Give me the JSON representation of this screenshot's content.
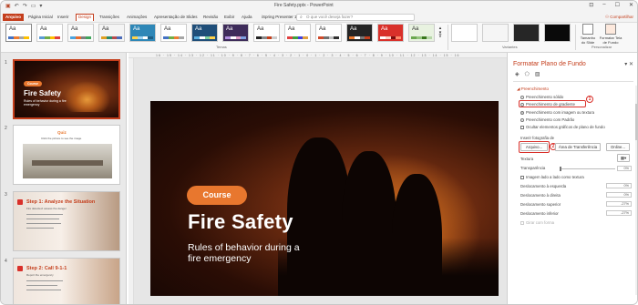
{
  "window": {
    "doc_title": "Fire Safety.pptx - PowerPoint",
    "search_placeholder": "O que você deseja fazer?",
    "share_label": "Compartilhar"
  },
  "tabs": [
    {
      "label": "Arquivo",
      "active": false
    },
    {
      "label": "Página Inicial",
      "active": false
    },
    {
      "label": "Inserir",
      "active": false
    },
    {
      "label": "Design",
      "active": true
    },
    {
      "label": "Transições",
      "active": false
    },
    {
      "label": "Animações",
      "active": false
    },
    {
      "label": "Apresentação de Slides",
      "active": false
    },
    {
      "label": "Revisão",
      "active": false
    },
    {
      "label": "Exibir",
      "active": false
    },
    {
      "label": "Ajuda",
      "active": false
    },
    {
      "label": "iSpring Presenter 10",
      "active": false
    }
  ],
  "ribbon": {
    "themes_group_label": "Temas",
    "variants_group_label": "Variantes",
    "customize_group_label": "Personalizar",
    "slide_size_label": "Tamanho do Slide",
    "format_background_label": "Formatar Tela de Fundo",
    "theme_sample_text": "Aa",
    "themes": [
      {
        "bg": "#ffffff",
        "text": "#333333",
        "bar": [
          "#4472c4",
          "#ed7d31",
          "#a5a5a5",
          "#ffc000"
        ]
      },
      {
        "bg": "#ffffff",
        "text": "#333333",
        "bar": [
          "#5b9bd5",
          "#70ad47",
          "#ffc000",
          "#e04040"
        ]
      },
      {
        "bg": "#fafafa",
        "text": "#333333",
        "bar": [
          "#4aa3df",
          "#e86b2d",
          "#7f7f7f",
          "#3fa55b"
        ]
      },
      {
        "bg": "#f4f4f4",
        "text": "#333333",
        "bar": [
          "#e0a020",
          "#2a8a6a",
          "#b84a4a",
          "#4a6ab8"
        ]
      },
      {
        "bg": "#2e87b7",
        "text": "#ffffff",
        "bar": [
          "#ffd44a",
          "#9fd3f0",
          "#ffffff",
          "#1d5e85"
        ]
      },
      {
        "bg": "#ffffff",
        "text": "#333333",
        "bar": [
          "#4472c4",
          "#70ad47",
          "#ed7d31",
          "#a5a5a5"
        ]
      },
      {
        "bg": "#1f4e79",
        "text": "#ffffff",
        "bar": [
          "#5ab0e0",
          "#ffffff",
          "#7fd1a0",
          "#ffd24a"
        ]
      },
      {
        "bg": "#3e2c5a",
        "text": "#ffffff",
        "bar": [
          "#b18ee0",
          "#ffffff",
          "#e0a0c8",
          "#7fa0e0"
        ]
      },
      {
        "bg": "#ffffff",
        "text": "#333333",
        "bar": [
          "#222222",
          "#888888",
          "#c43e1c",
          "#cccccc"
        ]
      },
      {
        "bg": "#ffffff",
        "text": "#333333",
        "bar": [
          "#e04040",
          "#40a040",
          "#4040e0",
          "#e0a040"
        ]
      },
      {
        "bg": "#ffffff",
        "text": "#333333",
        "bar": [
          "#d04a2a",
          "#707070",
          "#c0c0c0",
          "#303030"
        ]
      },
      {
        "bg": "#242424",
        "text": "#ffffff",
        "bar": [
          "#e8772e",
          "#ffffff",
          "#777777",
          "#c43e1c"
        ]
      },
      {
        "bg": "#d9302a",
        "text": "#ffffff",
        "bar": [
          "#ffffff",
          "#ffd2c8",
          "#7a1010",
          "#ff8a6a"
        ]
      },
      {
        "bg": "#e8f2e0",
        "text": "#333333",
        "bar": [
          "#6aa84f",
          "#93c47d",
          "#38761d",
          "#b6d7a8"
        ]
      }
    ],
    "variants": [
      "#ffffff",
      "#f5f5f5",
      "#262626",
      "#0a0a0a"
    ]
  },
  "ruler_text": "16 · 15 · 14 · 13 · 12 · 11 · 10 · 9 · 8 · 7 · 6 · 5 · 4 · 3 · 2 · 1 · 0 · 1 · 2 · 3 · 4 · 5 · 6 · 7 · 8 · 9 · 10 · 11 · 12 · 13 · 14 · 15 · 16",
  "thumbnails": [
    {
      "num": "1",
      "pill": "Course",
      "title": "Fire Safety",
      "sub": "Rules of behavior during a fire emergency",
      "selected": true
    },
    {
      "num": "2",
      "title": "Quiz",
      "sub": "Click the picture to see the image",
      "selected": false
    },
    {
      "num": "3",
      "title": "Step 1: Analyze the Situation",
      "sub": "Fire detected: assess the danger",
      "selected": false
    },
    {
      "num": "4",
      "title": "Step 2: Call 9-1-1",
      "sub": "Report the emergency",
      "selected": false
    }
  ],
  "slide": {
    "pill": "Course",
    "title": "Fire Safety",
    "subtitle": "Rules of behavior during a fire emergency"
  },
  "pane": {
    "title": "Formatar Plano de Fundo",
    "section_fill": "Preenchimento",
    "options": [
      {
        "label": "Preenchimento sólido",
        "checked": false
      },
      {
        "label": "Preenchimento de gradiente",
        "checked": false
      },
      {
        "label": "Preenchimento com imagem ou textura",
        "checked": true
      },
      {
        "label": "Preenchimento com Padrão",
        "checked": false
      }
    ],
    "hide_graphics": "Ocultar elementos gráficos de plano de fundo",
    "image_source": "Inserir fotografia de",
    "btn_file": "Arquivo...",
    "btn_clipboard": "Área de Transferência",
    "btn_online": "Online...",
    "texture_label": "Textura",
    "transparency_label": "Transparência",
    "tile_label": "Imagem lado a lado como textura",
    "offsets": [
      {
        "label": "Deslocamento à esquerda",
        "value": "0%"
      },
      {
        "label": "Deslocamento à direita",
        "value": "0%"
      },
      {
        "label": "Deslocamento superior",
        "value": "-27%"
      },
      {
        "label": "Deslocamento inferior",
        "value": "-27%"
      }
    ],
    "transparency_value": "0%",
    "rotate_label": "Girar com forma",
    "badge_1": "1",
    "badge_2": "2"
  }
}
